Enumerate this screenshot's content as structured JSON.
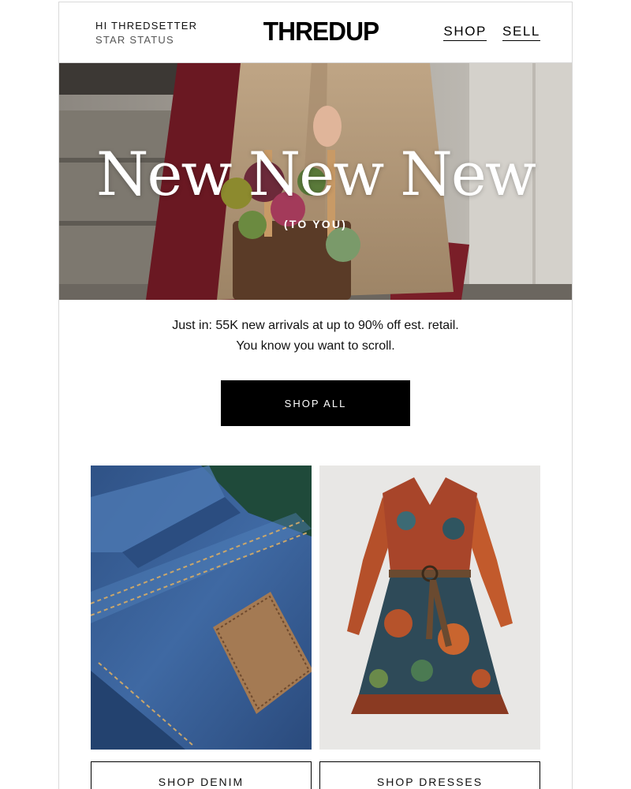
{
  "header": {
    "greeting": "HI THREDSETTER",
    "status": "STAR STATUS",
    "logo": "THREDUP",
    "nav": {
      "shop": "SHOP",
      "sell": "SELL"
    }
  },
  "hero": {
    "title": "New New New",
    "subtitle": "(TO YOU)"
  },
  "intro": {
    "line1": "Just in: 55K new arrivals at up to 90% off est. retail.",
    "line2": "You know you want to scroll."
  },
  "cta": {
    "shop_all": "SHOP ALL"
  },
  "products": [
    {
      "button": "SHOP DENIM"
    },
    {
      "button": "SHOP DRESSES"
    }
  ],
  "colors": {
    "black": "#000000",
    "border": "#d9d9d9",
    "white": "#ffffff"
  }
}
